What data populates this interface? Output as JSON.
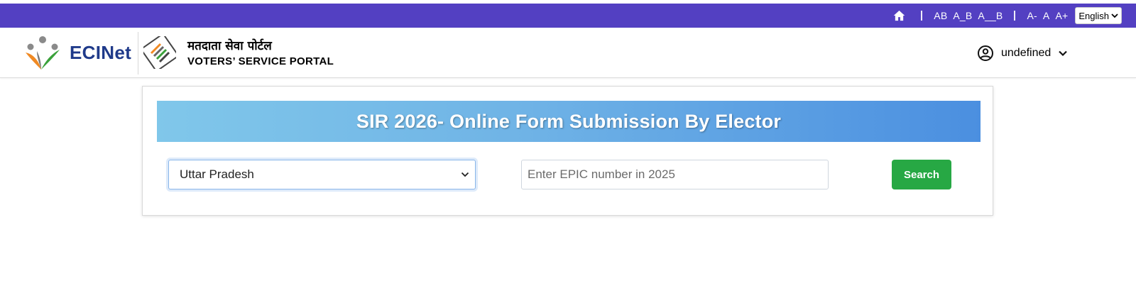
{
  "topbar": {
    "font_controls": [
      "AB",
      "A_B",
      "A__B"
    ],
    "size_controls": [
      "A-",
      "A",
      "A+"
    ],
    "language": "English",
    "bg_color": "#5340c2"
  },
  "header": {
    "brand": "ECINet",
    "portal_hindi": "मतदाता सेवा पोर्टल",
    "portal_english": "VOTERS’ SERVICE PORTAL",
    "user_name": "undefined",
    "brand_color": "#1f3a8a"
  },
  "main": {
    "banner_title": "SIR 2026- Online Form Submission By Elector",
    "state_value": "Uttar Pradesh",
    "epic_placeholder": "Enter EPIC number in 2025",
    "search_label": "Search",
    "search_color": "#27a844"
  },
  "icons": {
    "home": "home-icon",
    "user": "user-circle-icon",
    "dropdown": "chevron-down-icon"
  }
}
